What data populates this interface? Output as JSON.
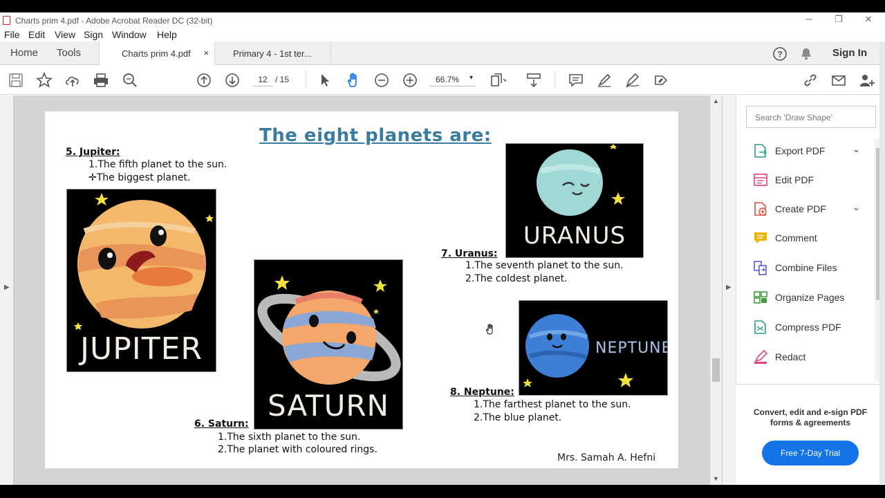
{
  "window": {
    "title": "Charts prim 4.pdf - Adobe Acrobat Reader DC (32-bit)",
    "minimize": "─",
    "restore": "❐",
    "close": "✕"
  },
  "menu": [
    "File",
    "Edit",
    "View",
    "Sign",
    "Window",
    "Help"
  ],
  "tabs": {
    "home": "Home",
    "tools": "Tools",
    "doc_active": "Charts prim 4.pdf",
    "doc_active_close": "×",
    "doc_inactive": "Primary 4 - 1st ter...",
    "sign_in": "Sign In"
  },
  "toolbar": {
    "page_current": "12",
    "page_total": "/ 15",
    "zoom": "66.7%",
    "zoom_caret": "▾"
  },
  "page": {
    "title": "The eight planets are:",
    "jupiter": {
      "heading": "5. Jupiter:",
      "line1": "1.The fifth planet to the sun.",
      "line2": "✛The biggest planet.",
      "label": "JUPITER"
    },
    "saturn": {
      "heading": "6. Saturn:",
      "line1": "1.The sixth planet to the sun.",
      "line2": "2.The planet with coloured rings.",
      "label": "SATURN"
    },
    "uranus": {
      "heading": "7. Uranus:",
      "line1": "1.The seventh planet to the sun.",
      "line2": "2.The coldest planet.",
      "label": "URANUS"
    },
    "neptune": {
      "heading": "8. Neptune:",
      "line1": "1.The farthest planet to the sun.",
      "line2": "2.The blue planet.",
      "label": "NEPTUNE"
    },
    "author": "Mrs. Samah A. Hefni"
  },
  "tools_panel": {
    "search_placeholder": "Search 'Draw Shape'",
    "items": [
      {
        "label": "Export PDF",
        "color": "#2d9e8f",
        "chevron": "⌄"
      },
      {
        "label": "Edit PDF",
        "color": "#e0427b"
      },
      {
        "label": "Create PDF",
        "color": "#e24e3b",
        "chevron": "⌄"
      },
      {
        "label": "Comment",
        "color": "#f0b400"
      },
      {
        "label": "Combine Files",
        "color": "#5b5bd6"
      },
      {
        "label": "Organize Pages",
        "color": "#3d9e3a"
      },
      {
        "label": "Compress PDF",
        "color": "#2d9e8f"
      },
      {
        "label": "Redact",
        "color": "#e0427b"
      }
    ],
    "promo_text": "Convert, edit and e-sign PDF forms & agreements",
    "promo_button": "Free 7-Day Trial"
  },
  "colors": {
    "accent": "#1473e6",
    "title_blue": "#3a7ca0"
  }
}
